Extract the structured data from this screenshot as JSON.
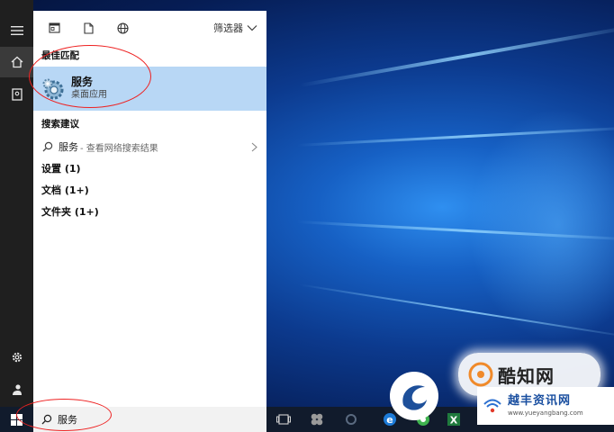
{
  "rail": {
    "items": [
      {
        "name": "hamburger-menu",
        "icon": "hamburger-icon"
      },
      {
        "name": "home",
        "icon": "home-icon",
        "active": true
      },
      {
        "name": "documents",
        "icon": "document-icon"
      },
      {
        "name": "settings",
        "icon": "gear-icon"
      },
      {
        "name": "user",
        "icon": "user-icon"
      }
    ]
  },
  "panel": {
    "top_icons": [
      "apps-icon",
      "document-icon",
      "globe-icon"
    ],
    "filter_label": "筛选器",
    "best_match": {
      "heading": "最佳匹配",
      "name": "服务",
      "type": "桌面应用"
    },
    "suggestions": {
      "heading": "搜索建议",
      "items": [
        {
          "query": "服务",
          "hint": "- 查看网络搜索结果"
        }
      ]
    },
    "categories": [
      {
        "label": "设置 (1)"
      },
      {
        "label": "文档 (1+)"
      },
      {
        "label": "文件夹 (1+)"
      }
    ]
  },
  "taskbar": {
    "search_value": "服务",
    "pinned": [
      "task-view-icon",
      "app-icon",
      "edge-icon",
      "browser-icon",
      "excel-icon"
    ]
  },
  "watermarks": {
    "badge_text": "酷知网",
    "card_title": "越丰资讯网",
    "card_url": "www.yueyangbang.com"
  },
  "colors": {
    "selection": "#b8d7f5",
    "rail_bg": "#1f1f1f",
    "taskbar_bg": "#111b2c",
    "annotation": "#ee2222"
  }
}
